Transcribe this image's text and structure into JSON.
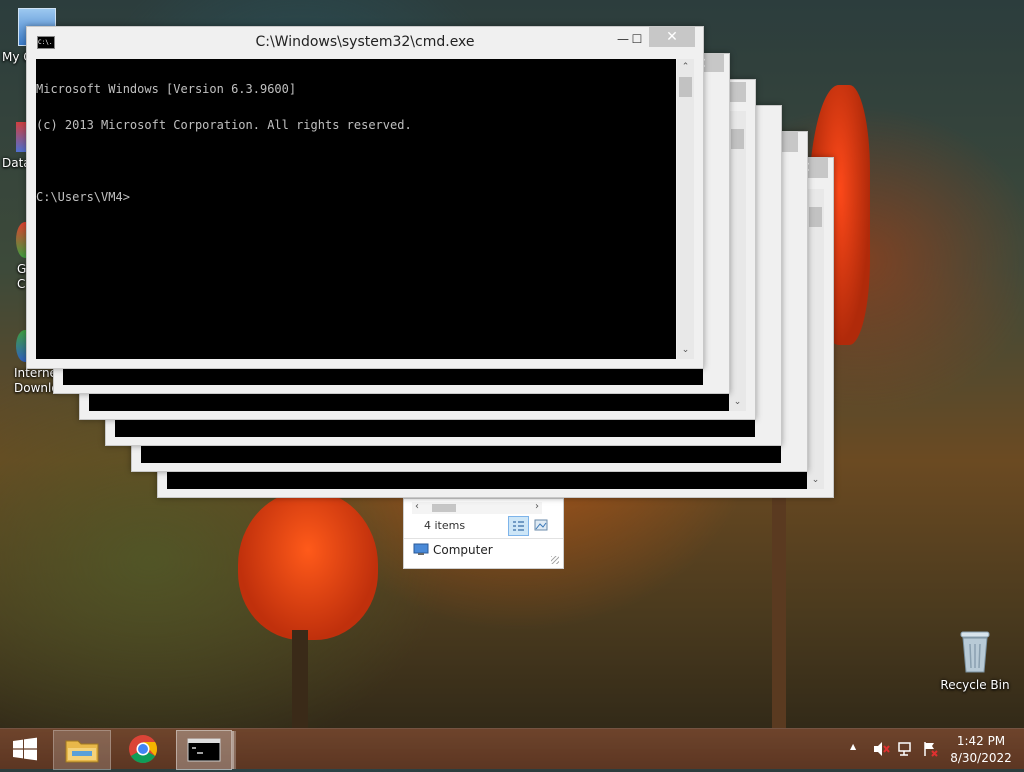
{
  "desktop": {
    "icons": [
      {
        "label": "My C"
      },
      {
        "label": "Data"
      },
      {
        "label": "G\nC"
      },
      {
        "label": "Interne\nDownlo"
      }
    ],
    "recycle_bin": {
      "label": "Recycle Bin"
    }
  },
  "cmd_window": {
    "title": "C:\\Windows\\system32\\cmd.exe",
    "icon_text": "C:\\.",
    "minimize": "—",
    "maximize": "☐",
    "close": "✕",
    "lines": [
      "Microsoft Windows [Version 6.3.9600]",
      "(c) 2013 Microsoft Corporation. All rights reserved.",
      "",
      "C:\\Users\\VM4>"
    ]
  },
  "explorer": {
    "items_count": "4 items",
    "location": "Computer"
  },
  "taskbar": {
    "clock_time": "1:42 PM",
    "clock_date": "8/30/2022",
    "tray_arrow": "▲"
  },
  "colors": {
    "console_bg": "#000000",
    "console_fg": "#c0c0c0",
    "taskbar": "#6e4330",
    "close_btn": "#c7c7c7"
  }
}
